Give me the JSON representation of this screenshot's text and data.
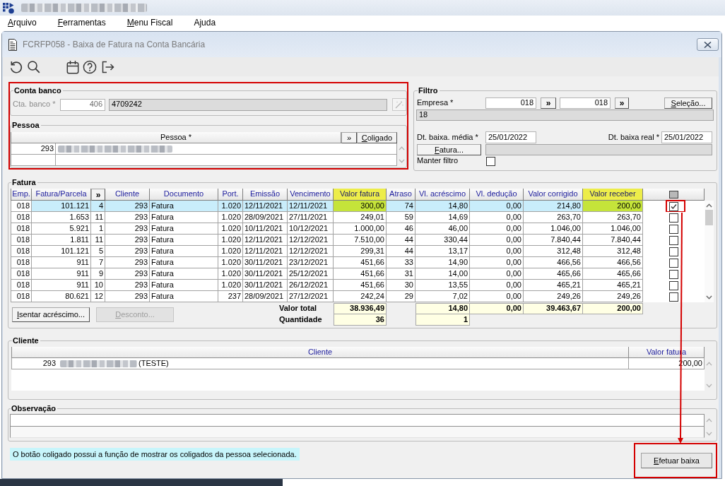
{
  "app": {
    "title_redacted": true,
    "menu": [
      {
        "label": "Arquivo",
        "mnemonic": true
      },
      {
        "label": "Ferramentas",
        "mnemonic": true
      },
      {
        "label": "Menu Fiscal",
        "mnemonic": true
      },
      {
        "label": "Ajuda",
        "mnemonic": false
      }
    ]
  },
  "window": {
    "title": "FCRFP058 - Baixa de Fatura na Conta Bancária"
  },
  "account_panel": {
    "annotated": true,
    "conta_banco": {
      "legend": "Conta banco",
      "label": "Cta. banco *",
      "code": "406",
      "account": "4709242",
      "disabled": true
    },
    "pessoa": {
      "legend": "Pessoa",
      "column": "Pessoa *",
      "buttons": [
        "»",
        "Coligado"
      ],
      "rows": [
        {
          "code": "293",
          "redacted": true
        }
      ]
    }
  },
  "filtro": {
    "legend": "Filtro",
    "empresa": {
      "label": "Empresa *",
      "range": [
        {
          "value": "018",
          "button": "»"
        },
        {
          "value": "018",
          "button": "»"
        }
      ],
      "description": "18"
    },
    "selection_button": "Seleção...",
    "dt_media": {
      "label": "Dt. baixa. média *",
      "value": "25/01/2022"
    },
    "dt_real": {
      "label": "Dt. baixa real *",
      "value": "25/01/2022"
    },
    "fatura_button": "Fatura...",
    "manter_filtro": {
      "label": "Manter filtro",
      "checked": false
    }
  },
  "fatura": {
    "legend": "Fatura",
    "columns": [
      {
        "label": "Emp.",
        "kind": "number",
        "highlighted": false
      },
      {
        "label": "Fatura/Parcela",
        "kind": "number",
        "highlighted": false
      },
      {
        "label": "»",
        "kind": "toggle",
        "highlighted": false
      },
      {
        "label": "Cliente",
        "kind": "number",
        "highlighted": false
      },
      {
        "label": "Documento",
        "kind": "text",
        "highlighted": false
      },
      {
        "label": "Port.",
        "kind": "number",
        "highlighted": false
      },
      {
        "label": "Emissão",
        "kind": "text",
        "highlighted": false
      },
      {
        "label": "Vencimento",
        "kind": "text",
        "highlighted": false
      },
      {
        "label": "Valor fatura",
        "kind": "number",
        "highlighted": true
      },
      {
        "label": "Atraso",
        "kind": "number",
        "highlighted": false
      },
      {
        "label": "Vl. acréscimo",
        "kind": "number",
        "highlighted": false
      },
      {
        "label": "Vl. dedução",
        "kind": "number",
        "highlighted": false
      },
      {
        "label": "Valor corrigido",
        "kind": "number",
        "highlighted": false
      },
      {
        "label": "Valor receber",
        "kind": "number",
        "highlighted": true
      },
      {
        "kind": "check",
        "highlighted": false
      }
    ],
    "rows": [
      {
        "cells": [
          "018",
          "101.121",
          "4",
          "293",
          "Fatura",
          "1.020",
          "12/11/2021",
          "12/11/2021",
          "300,00",
          "74",
          "14,80",
          "0,00",
          "214,80",
          "200,00"
        ],
        "selected": true,
        "checked": true,
        "annotated": true
      },
      {
        "cells": [
          "018",
          "1.653",
          "11",
          "293",
          "Fatura",
          "1.020",
          "28/09/2021",
          "27/11/2021",
          "249,01",
          "59",
          "14,69",
          "0,00",
          "263,70",
          "263,70"
        ],
        "selected": false,
        "checked": false,
        "annotated": false
      },
      {
        "cells": [
          "018",
          "5.921",
          "1",
          "293",
          "Fatura",
          "1.020",
          "10/11/2021",
          "10/12/2021",
          "1.000,00",
          "46",
          "46,00",
          "0,00",
          "1.046,00",
          "1.046,00"
        ],
        "selected": false,
        "checked": false,
        "annotated": false
      },
      {
        "cells": [
          "018",
          "1.811",
          "11",
          "293",
          "Fatura",
          "1.020",
          "12/11/2021",
          "12/12/2021",
          "7.510,00",
          "44",
          "330,44",
          "0,00",
          "7.840,44",
          "7.840,44"
        ],
        "selected": false,
        "checked": false,
        "annotated": false
      },
      {
        "cells": [
          "018",
          "101.121",
          "5",
          "293",
          "Fatura",
          "1.020",
          "12/11/2021",
          "12/12/2021",
          "299,31",
          "44",
          "13,17",
          "0,00",
          "312,48",
          "312,48"
        ],
        "selected": false,
        "checked": false,
        "annotated": false
      },
      {
        "cells": [
          "018",
          "911",
          "7",
          "293",
          "Fatura",
          "1.020",
          "30/11/2021",
          "23/12/2021",
          "451,66",
          "33",
          "14,90",
          "0,00",
          "466,56",
          "466,56"
        ],
        "selected": false,
        "checked": false,
        "annotated": false
      },
      {
        "cells": [
          "018",
          "911",
          "9",
          "293",
          "Fatura",
          "1.020",
          "30/11/2021",
          "25/12/2021",
          "451,66",
          "31",
          "14,00",
          "0,00",
          "465,66",
          "465,66"
        ],
        "selected": false,
        "checked": false,
        "annotated": false
      },
      {
        "cells": [
          "018",
          "911",
          "10",
          "293",
          "Fatura",
          "1.020",
          "30/11/2021",
          "26/12/2021",
          "451,66",
          "30",
          "13,55",
          "0,00",
          "465,21",
          "465,21"
        ],
        "selected": false,
        "checked": false,
        "annotated": false
      },
      {
        "cells": [
          "018",
          "80.621",
          "12",
          "293",
          "Fatura",
          "237",
          "28/09/2021",
          "27/12/2021",
          "242,24",
          "29",
          "7,02",
          "0,00",
          "249,26",
          "249,26"
        ],
        "selected": false,
        "checked": false,
        "annotated": false
      }
    ],
    "totals": [
      {
        "label": "Valor total",
        "valor_fatura": "38.936,49",
        "vl_acrescimo": "14,80",
        "vl_deducao": "0,00",
        "valor_corrigido": "39.463,67",
        "valor_receber": "200,00"
      },
      {
        "label": "Quantidade",
        "valor_fatura": "36",
        "vl_acrescimo": "1"
      }
    ],
    "buttons": [
      {
        "label": "Isentar acréscimo...",
        "disabled": false
      },
      {
        "label": "Desconto...",
        "disabled": true
      }
    ]
  },
  "cliente": {
    "legend": "Cliente",
    "columns": [
      "Cliente",
      "Valor fatura"
    ],
    "rows": [
      {
        "code": "293",
        "redacted": true,
        "note": "(TESTE)",
        "valor_fatura": "200,00"
      }
    ]
  },
  "observacao": {
    "legend": "Observação"
  },
  "footer": {
    "hint": "O botão coligado possui a função de mostrar os coligados da pessoa selecionada.",
    "action": {
      "label": "Efetuar baixa",
      "annotated": true
    }
  }
}
